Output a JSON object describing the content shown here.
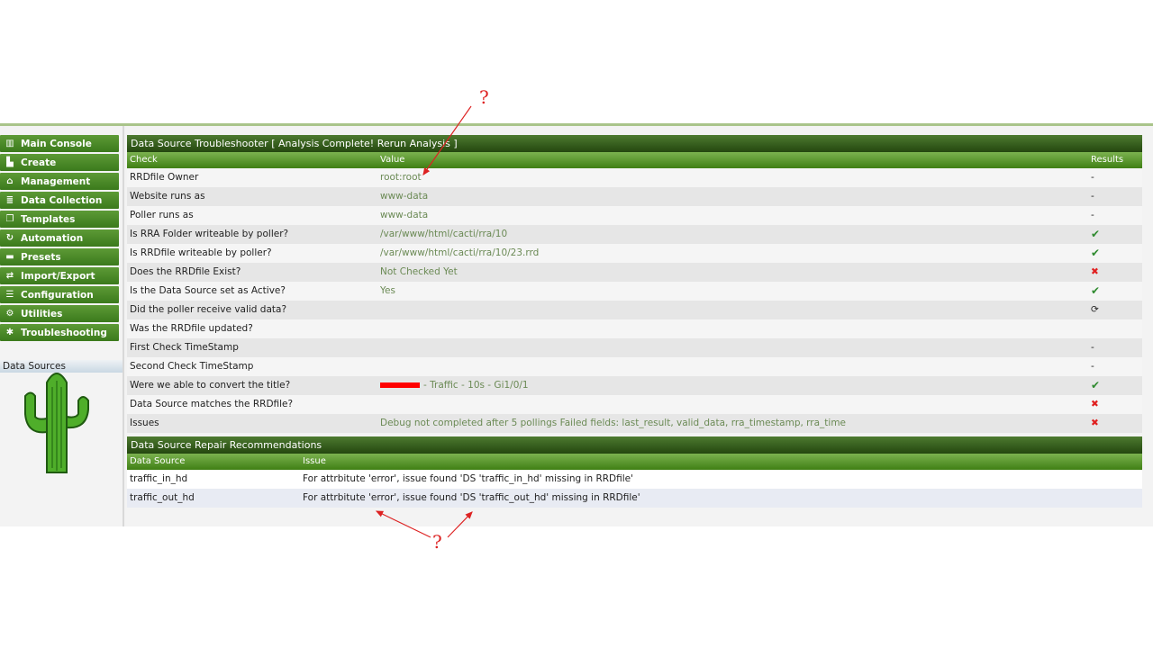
{
  "sidebar": {
    "items": [
      {
        "label": "Main Console",
        "icon": "map-icon",
        "glyph": "▥"
      },
      {
        "label": "Create",
        "icon": "chart-icon",
        "glyph": "▙"
      },
      {
        "label": "Management",
        "icon": "home-icon",
        "glyph": "⌂"
      },
      {
        "label": "Data Collection",
        "icon": "database-icon",
        "glyph": "≣"
      },
      {
        "label": "Templates",
        "icon": "copy-icon",
        "glyph": "❐"
      },
      {
        "label": "Automation",
        "icon": "refresh-icon",
        "glyph": "↻"
      },
      {
        "label": "Presets",
        "icon": "folder-icon",
        "glyph": "▬"
      },
      {
        "label": "Import/Export",
        "icon": "exchange-icon",
        "glyph": "⇄"
      },
      {
        "label": "Configuration",
        "icon": "sliders-icon",
        "glyph": "☰"
      },
      {
        "label": "Utilities",
        "icon": "gears-icon",
        "glyph": "⚙"
      },
      {
        "label": "Troubleshooting",
        "icon": "bug-icon",
        "glyph": "✱"
      }
    ],
    "sub_item": "Data Sources"
  },
  "troubleshooter": {
    "title": "Data Source Troubleshooter [ Analysis Complete! Rerun Analysis ]",
    "columns": [
      "Check",
      "Value",
      "Results"
    ],
    "rows": [
      {
        "check": "RRDfile Owner",
        "value": "root:root",
        "result": "-"
      },
      {
        "check": "Website runs as",
        "value": "www-data",
        "result": "-"
      },
      {
        "check": "Poller runs as",
        "value": "www-data",
        "result": "-"
      },
      {
        "check": "Is RRA Folder writeable by poller?",
        "value": "/var/www/html/cacti/rra/10",
        "result": "✔"
      },
      {
        "check": "Is RRDfile writeable by poller?",
        "value": "/var/www/html/cacti/rra/10/23.rrd",
        "result": "✔"
      },
      {
        "check": "Does the RRDfile Exist?",
        "value": "Not Checked Yet",
        "result": "✖"
      },
      {
        "check": "Is the Data Source set as Active?",
        "value": "Yes",
        "result": "✔"
      },
      {
        "check": "Did the poller receive valid data?",
        "value": "",
        "result": "⟳"
      },
      {
        "check": "Was the RRDfile updated?",
        "value": "",
        "result": ""
      },
      {
        "check": "First Check TimeStamp",
        "value": "",
        "result": "-"
      },
      {
        "check": "Second Check TimeStamp",
        "value": "",
        "result": "-"
      },
      {
        "check": "Were we able to convert the title?",
        "value": "- Traffic - 10s - Gi1/0/1",
        "result": "✔",
        "redacted": true
      },
      {
        "check": "Data Source matches the RRDfile?",
        "value": "",
        "result": "✖"
      },
      {
        "check": "Issues",
        "value": "Debug not completed after 5 pollings Failed fields: last_result, valid_data, rra_timestamp, rra_time",
        "result": "✖"
      }
    ]
  },
  "repair": {
    "title": "Data Source Repair Recommendations",
    "columns": [
      "Data Source",
      "Issue"
    ],
    "rows": [
      {
        "ds": "traffic_in_hd",
        "issue": "For attrbitute 'error', issue found 'DS 'traffic_in_hd' missing in RRDfile'"
      },
      {
        "ds": "traffic_out_hd",
        "issue": "For attrbitute 'error', issue found 'DS 'traffic_out_hd' missing in RRDfile'"
      }
    ]
  },
  "annotations": {
    "top_mark": "?",
    "bottom_mark": "?"
  },
  "colors": {
    "ok": "#2f8a2f",
    "error": "#e02020",
    "header": "#24470f",
    "accent": "#3f7f14"
  }
}
